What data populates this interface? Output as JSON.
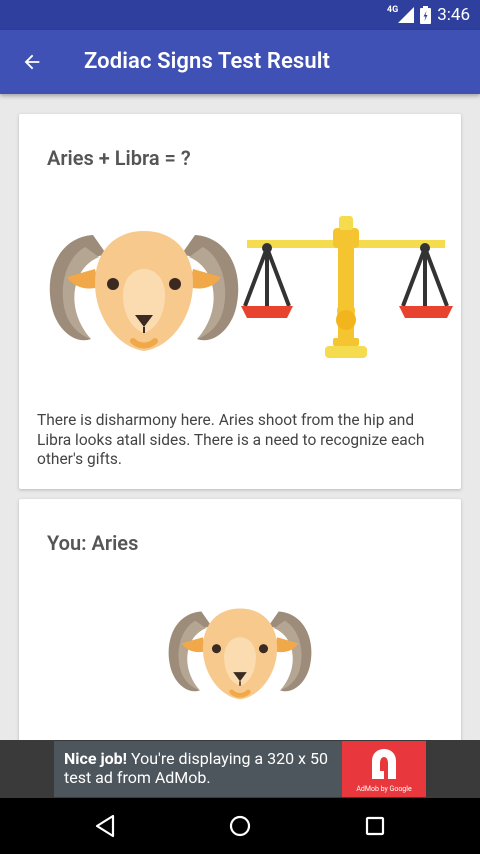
{
  "status_bar": {
    "network": "4G",
    "time": "3:46"
  },
  "app_bar": {
    "title": "Zodiac Signs Test Result",
    "back_icon": "arrow-back-icon"
  },
  "result_card": {
    "title": "Aries + Libra = ?",
    "image_left": "aries-ram",
    "image_right": "libra-scales",
    "description": "There is disharmony here. Aries shoot from the hip and Libra looks atall sides. There is a need to recognize each other's gifts."
  },
  "you_card": {
    "title": "You: Aries",
    "image": "aries-ram"
  },
  "ad": {
    "headline": "Nice job!",
    "body": " You're displaying a 320 x 50 test ad from AdMob.",
    "logo_caption": "AdMob by Google"
  },
  "nav_bar": {
    "back": "back-triangle-icon",
    "home": "home-circle-icon",
    "recents": "recents-square-icon"
  },
  "colors": {
    "status_bar": "#2f3f9e",
    "app_bar": "#3f51b5",
    "ad_logo": "#e8383d"
  }
}
